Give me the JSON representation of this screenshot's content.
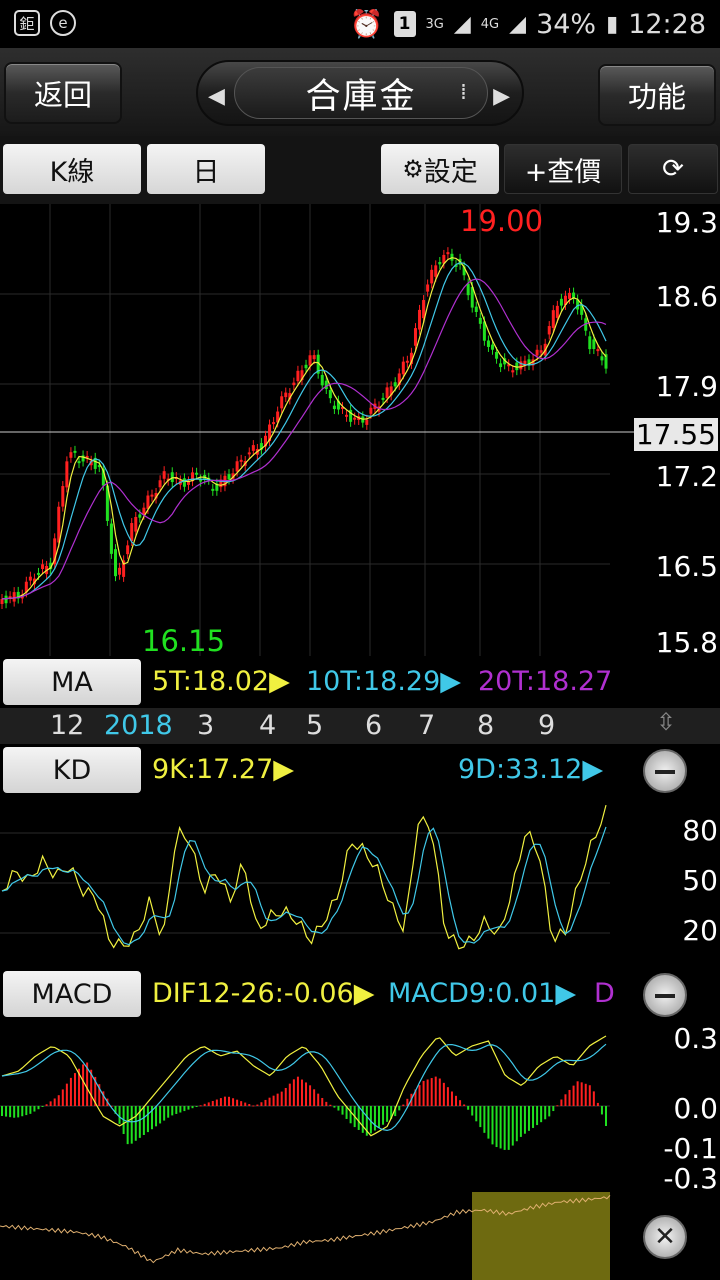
{
  "status_bar": {
    "carrier_icon": "鉅",
    "app_icon": "e",
    "sim_slot": "1",
    "net1": "3G",
    "net2": "4G",
    "battery": "34%",
    "time": "12:28"
  },
  "header": {
    "back_label": "返回",
    "title": "合庫金",
    "function_label": "功能"
  },
  "toolbar": {
    "chart_type": "K線",
    "period": "日",
    "settings_label": "設定",
    "quote_label": "+查價",
    "icons": {
      "settings": "gear-icon",
      "rotate": "rotate-icon"
    }
  },
  "main_chart": {
    "y_labels": [
      "19.3",
      "18.6",
      "17.9",
      "17.55",
      "17.2",
      "16.5",
      "15.8"
    ],
    "high_label": "19.00",
    "low_label": "16.15",
    "current_price": "17.55"
  },
  "ma_bar": {
    "button": "MA",
    "ma5": "5T:18.02",
    "ma10": "10T:18.29",
    "ma20": "20T:18.27"
  },
  "months": [
    "12",
    "2018",
    "3",
    "4",
    "5",
    "6",
    "7",
    "8",
    "9"
  ],
  "kd_bar": {
    "button": "KD",
    "k": "9K:17.27",
    "d": "9D:33.12",
    "y_labels": [
      "80",
      "50",
      "20"
    ]
  },
  "macd_bar": {
    "button": "MACD",
    "dif": "DIF12-26:-0.06",
    "macd": "MACD9:0.01",
    "osc": "D",
    "y_labels": [
      "0.3",
      "0.0",
      "-0.1",
      "-0.3"
    ]
  },
  "colors": {
    "up": "#ff2020",
    "down": "#20e020",
    "ma5": "#f0f040",
    "ma10": "#40c8e8",
    "ma20": "#b030d0",
    "highlight": "#6e6a10"
  }
}
